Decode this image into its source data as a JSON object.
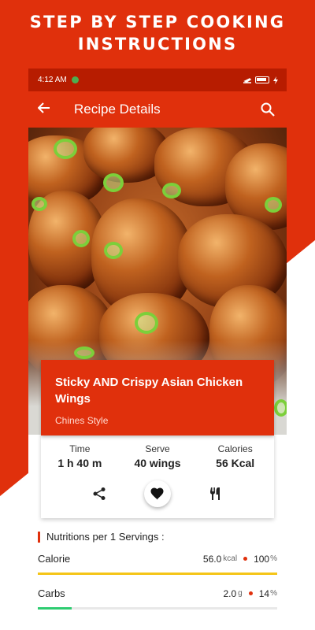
{
  "promo": {
    "line1": "STEP BY STEP COOKING",
    "line2": "INSTRUCTIONS"
  },
  "status_bar": {
    "time": "4:12 AM"
  },
  "app_bar": {
    "title": "Recipe Details",
    "back_icon": "arrow-back-icon",
    "search_icon": "search-icon"
  },
  "recipe": {
    "name": "Sticky AND Crispy Asian Chicken Wings",
    "style": "Chines Style"
  },
  "stats": [
    {
      "label": "Time",
      "value": "1 h 40 m"
    },
    {
      "label": "Serve",
      "value": "40 wings"
    },
    {
      "label": "Calories",
      "value": "56 Kcal"
    }
  ],
  "actions": {
    "share_icon": "share-icon",
    "favorite_icon": "heart-icon",
    "cook_icon": "fork-knife-icon"
  },
  "nutrition": {
    "title": "Nutritions per 1 Servings :",
    "items": [
      {
        "name": "Calorie",
        "amount": "56.0",
        "unit": "kcal",
        "percent": "100",
        "percent_unit": "%",
        "level": 1.0,
        "color": "#f5c518"
      },
      {
        "name": "Carbs",
        "amount": "2.0",
        "unit": "g",
        "percent": "14",
        "percent_unit": "%",
        "level": 0.14,
        "color": "#2ecc71"
      }
    ]
  },
  "colors": {
    "primary": "#e0300c",
    "status_bar": "#b71c00"
  }
}
